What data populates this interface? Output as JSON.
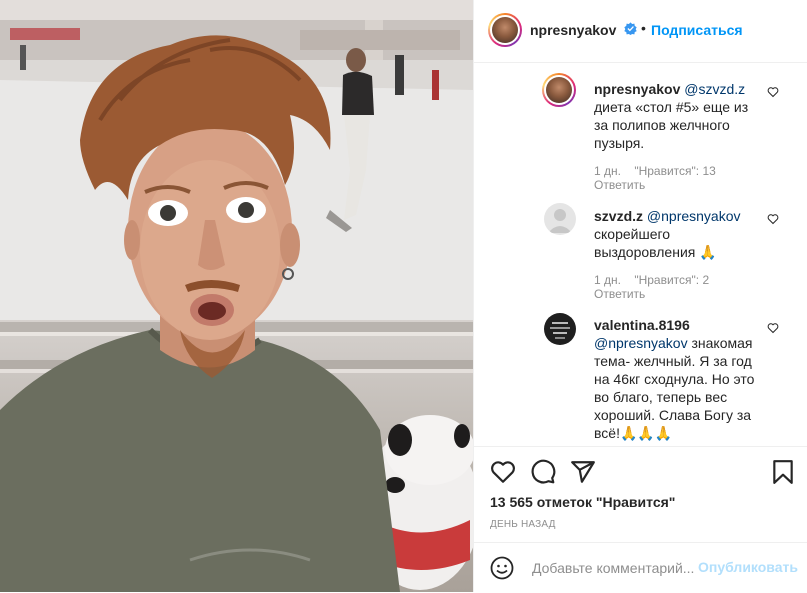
{
  "post": {
    "author": "npresnyakov",
    "verified": true,
    "dot": "•",
    "follow_label": "Подписаться"
  },
  "comments": [
    {
      "user": "npresnyakov",
      "mention": "@szvzd.z",
      "text_lines": [
        "диета «стол #5» еще из",
        "за полипов желчного",
        "пузыря."
      ],
      "age": "1 дн.",
      "likes": "\"Нравится\": 13",
      "reply": "Ответить"
    },
    {
      "user": "szvzd.z",
      "mention": "@npresnyakov",
      "text_lines": [
        "скорейшего",
        "выздоровления 🙏"
      ],
      "age": "1 дн.",
      "likes": "\"Нравится\": 2",
      "reply": "Ответить"
    },
    {
      "user": "valentina.8196",
      "mention": "@npresnyakov",
      "text_lines": [
        "знакомая",
        "тема- желчный. Я за год",
        "на 46кг сходнула. Но это",
        "во благо, теперь вес",
        "хороший. Слава Богу за",
        "всё!🙏🙏🙏"
      ]
    }
  ],
  "actions": {
    "likes_count": "13 565 отметок \"Нравится\"",
    "time": "ДЕНЬ НАЗАД"
  },
  "add_comment": {
    "placeholder": "Добавьте комментарий...",
    "post_label": "Опубликовать"
  },
  "colors": {
    "accent": "#0095f6",
    "mention": "#00376b",
    "muted": "#8e8e8e",
    "post_disabled": "#b2dffc"
  },
  "icons": [
    "heart-icon",
    "comment-icon",
    "share-icon",
    "bookmark-icon",
    "emoji-icon",
    "verified-badge-icon"
  ]
}
